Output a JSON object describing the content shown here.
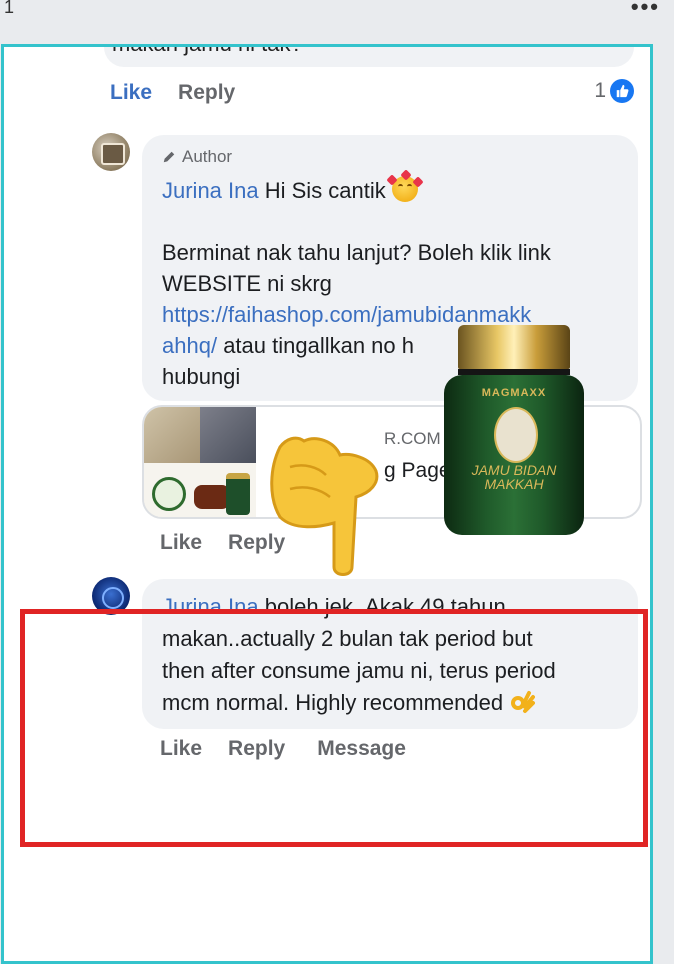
{
  "page_number": "1",
  "more_menu": "•••",
  "previous_comment": {
    "text_fragment": "makan jamu ni tak?",
    "actions": {
      "like": "Like",
      "reply": "Reply"
    },
    "reaction_count": "1",
    "reaction_icon": "thumbs-up-icon"
  },
  "author_reply": {
    "author_tag": "Author",
    "name": "Jurina Ina",
    "greeting": "Hi Sis cantik",
    "line2": "Berminat nak tahu lanjut? Boleh klik link",
    "line3": "WEBSITE ni skrg",
    "link_line1": "https://faihashop.com/jamubidanmakk",
    "link_line2": "ahhq/",
    "after_link": "atau tingallkan no h",
    "line6": "hubungi",
    "link_preview": {
      "domain_fragment": "R.COM",
      "title_fragment": "g Page –"
    },
    "actions": {
      "like": "Like",
      "reply": "Reply"
    }
  },
  "highlighted_reply": {
    "name": "Jurina Ina",
    "line1": "boleh jek..Akak 49 tahun",
    "line2": "makan..actually 2 bulan tak period but",
    "line3": "then after consume jamu ni, terus period",
    "line4": "mcm normal. Highly recommended",
    "emoji": "ok-hand-icon",
    "actions": {
      "like": "Like",
      "reply": "Reply",
      "message": "Message"
    }
  },
  "product_overlay": {
    "brand": "MAGMAXX",
    "name_line1": "JAMU BIDAN",
    "name_line2": "MAKKAH"
  },
  "colors": {
    "frame": "#34c3cc",
    "highlight_box": "#e02424",
    "link": "#3b6fc0"
  }
}
